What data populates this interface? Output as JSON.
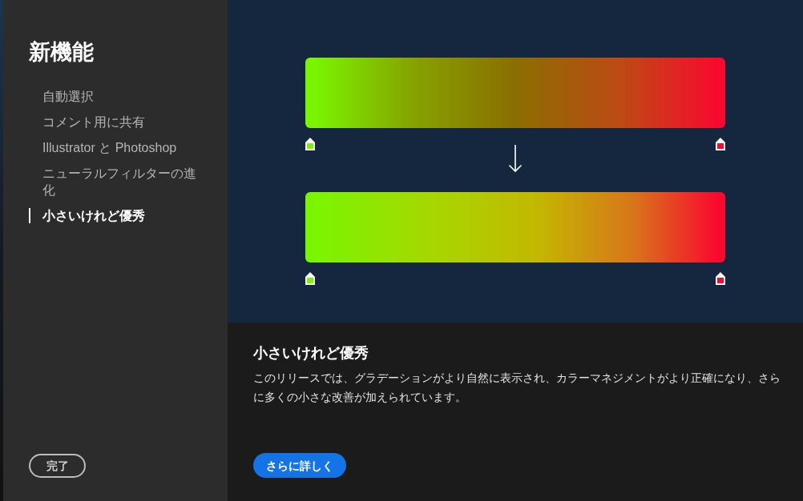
{
  "sidebar": {
    "title": "新機能",
    "items": [
      {
        "label": "自動選択",
        "selected": false
      },
      {
        "label": "コメント用に共有",
        "selected": false
      },
      {
        "label": "Illustrator と Photoshop",
        "selected": false
      },
      {
        "label": "ニューラルフィルターの進化",
        "selected": false
      },
      {
        "label": "小さいけれど優秀",
        "selected": true
      }
    ],
    "done_button": "完了"
  },
  "preview": {
    "gradients": [
      {
        "kind": "before",
        "stops": [
          {
            "color": "#7af500"
          },
          {
            "color": "#f80a2e"
          }
        ]
      },
      {
        "kind": "after",
        "stops": [
          {
            "color": "#7af500"
          },
          {
            "color": "#f80a2e"
          }
        ]
      }
    ]
  },
  "detail": {
    "title": "小さいけれど優秀",
    "body": "このリリースでは、グラデーションがより自然に表示され、カラーマネジメントがより正確になり、さらに多くの小さな改善が加えられています。",
    "button": "さらに詳しく"
  }
}
